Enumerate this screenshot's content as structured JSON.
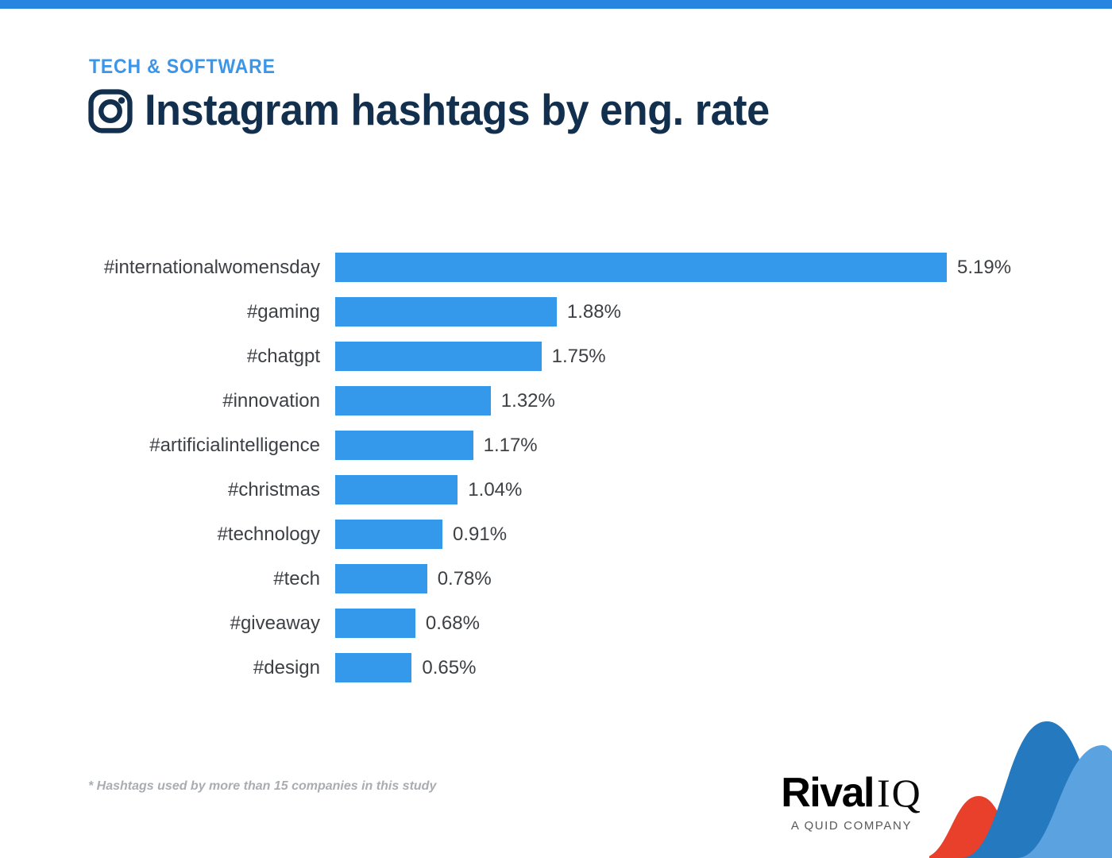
{
  "theme": {
    "accent_blue": "#3498eb",
    "top_bar_blue": "#2585e0",
    "title_navy": "#12304d",
    "label_gray": "#3d4044",
    "footnote_gray": "#a9adb2",
    "decor_red": "#e8402a",
    "decor_blue_dark": "#2579be",
    "decor_blue_light": "#5ba3e0"
  },
  "header": {
    "kicker": "TECH & SOFTWARE",
    "icon": "instagram-icon",
    "title": "Instagram hashtags by eng. rate"
  },
  "footnote": "* Hashtags used by more than 15 companies in this study",
  "logo": {
    "name_bold": "Rival",
    "name_light": "IQ",
    "tagline": "A QUID COMPANY"
  },
  "chart_data": {
    "type": "bar",
    "orientation": "horizontal",
    "title": "Instagram hashtags by eng. rate",
    "subtitle": "TECH & SOFTWARE",
    "xlabel": "",
    "ylabel": "",
    "grid": false,
    "legend": "none",
    "xlim": [
      0,
      5.19
    ],
    "unit": "%",
    "categories": [
      "#internationalwomensday",
      "#gaming",
      "#chatgpt",
      "#innovation",
      "#artificialintelligence",
      "#christmas",
      "#technology",
      "#tech",
      "#giveaway",
      "#design"
    ],
    "values": [
      5.19,
      1.88,
      1.75,
      1.32,
      1.17,
      1.04,
      0.91,
      0.78,
      0.68,
      0.65
    ],
    "value_labels": [
      "5.19%",
      "1.88%",
      "1.75%",
      "1.32%",
      "1.17%",
      "1.04%",
      "0.91%",
      "0.78%",
      "0.68%",
      "0.65%"
    ],
    "bar_color": "#3498eb",
    "annotations": [
      "* Hashtags used by more than 15 companies in this study"
    ]
  }
}
